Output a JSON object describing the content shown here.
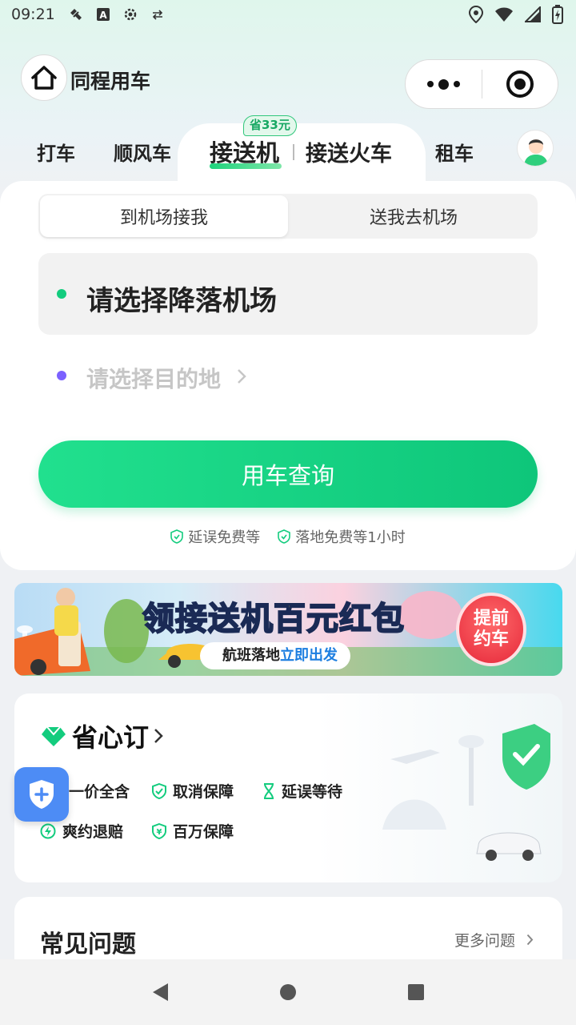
{
  "status_bar": {
    "time": "09:21"
  },
  "header": {
    "title": "同程用车"
  },
  "tabs": [
    {
      "label": "打车"
    },
    {
      "label": "顺风车"
    },
    {
      "label": "接送机",
      "badge": "省33元",
      "active": true
    },
    {
      "label": "接送火车"
    },
    {
      "label": "租车"
    }
  ],
  "segment": {
    "options": [
      "到机场接我",
      "送我去机场"
    ],
    "selected": "到机场接我"
  },
  "form": {
    "from_placeholder": "请选择降落机场",
    "to_placeholder": "请选择目的地",
    "submit_label": "用车查询",
    "guarantees": [
      "延误免费等",
      "落地免费等1小时"
    ]
  },
  "banner": {
    "title_part1": "领接送机",
    "title_part2": "百元红包",
    "sub_part1": "航班落地",
    "sub_part2": "立即出发",
    "cta_line1": "提前",
    "cta_line2": "约车"
  },
  "worry_free": {
    "title": "省心订",
    "features": [
      "一价全含",
      "取消保障",
      "延误等待",
      "爽约退赔",
      "百万保障"
    ]
  },
  "faq": {
    "title": "常见问题",
    "more_label": "更多问题"
  },
  "colors": {
    "accent": "#13CC7E",
    "text": "#222222",
    "placeholder": "#C6C6C6",
    "to_dot": "#7B61FF"
  }
}
